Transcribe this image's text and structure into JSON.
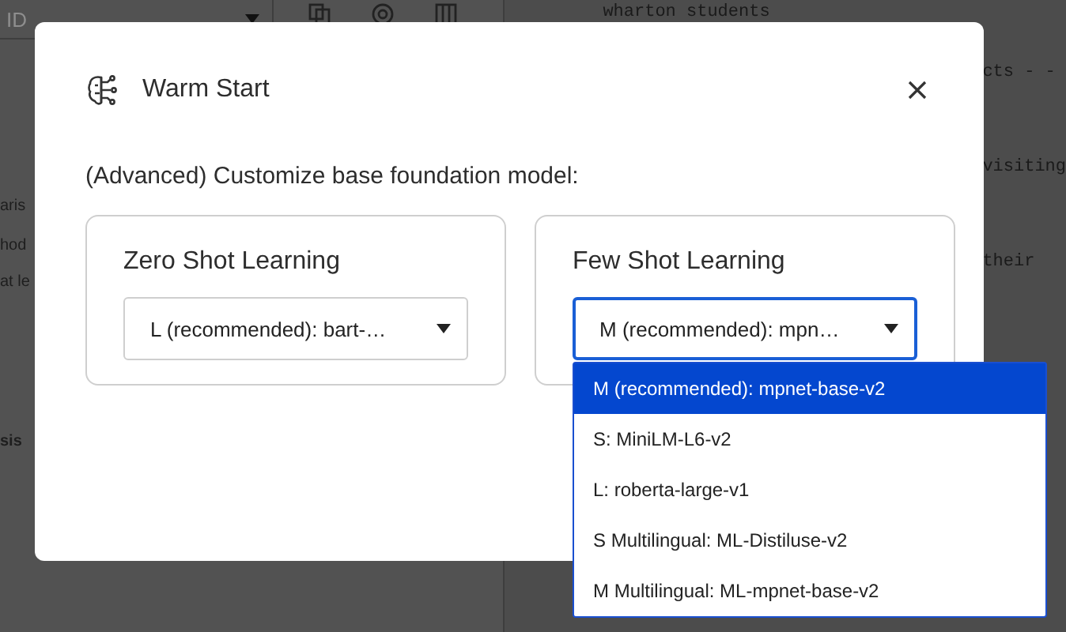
{
  "background": {
    "id_select": {
      "placeholder": "ID"
    },
    "sidebar_fragments": [
      "aris",
      "hod",
      "at le",
      "sis"
    ],
    "editor_lines": [
      "wharton students",
      "cts - -",
      "visiting",
      "their"
    ]
  },
  "dialog": {
    "title": "Warm Start",
    "prompt": "(Advanced) Customize base foundation model:",
    "sections": [
      {
        "title": "Zero Shot Learning",
        "value": "L (recommended): bart-…",
        "open": false
      },
      {
        "title": "Few Shot Learning",
        "value": "M (recommended): mpn…",
        "open": true
      }
    ],
    "menu": {
      "options": [
        {
          "label": "M (recommended): mpnet-base-v2",
          "selected": true
        },
        {
          "label": "S: MiniLM-L6-v2",
          "selected": false
        },
        {
          "label": "L: roberta-large-v1",
          "selected": false
        },
        {
          "label": "S Multilingual: ML-Distiluse-v2",
          "selected": false
        },
        {
          "label": "M Multilingual: ML-mpnet-base-v2",
          "selected": false
        }
      ]
    }
  }
}
